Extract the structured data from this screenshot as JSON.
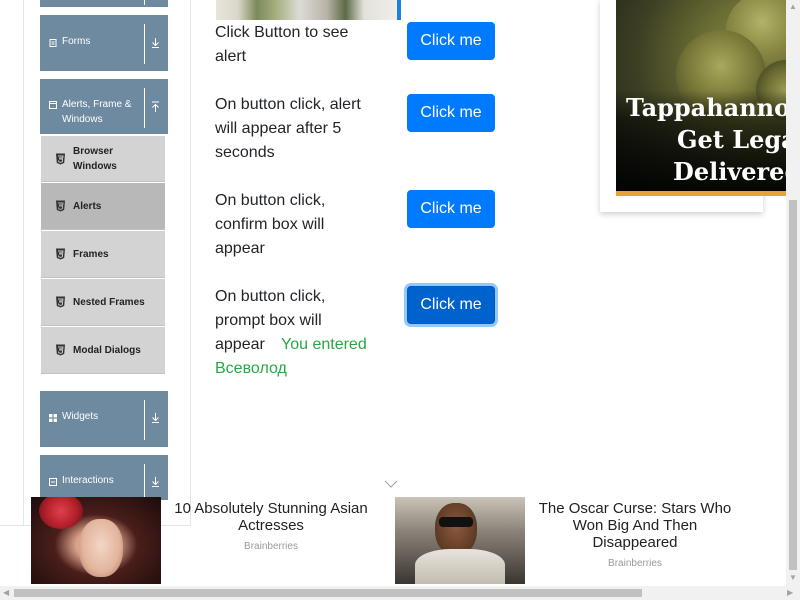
{
  "sidebar": {
    "groups": [
      {
        "label": "Forms"
      },
      {
        "label_line1": "Alerts, Frame &",
        "label_line2": "Windows"
      },
      {
        "label": "Widgets"
      },
      {
        "label": "Interactions"
      }
    ],
    "items": [
      {
        "label_line1": "Browser",
        "label_line2": "Windows"
      },
      {
        "label": "Alerts"
      },
      {
        "label": "Frames"
      },
      {
        "label": "Nested Frames"
      },
      {
        "label": "Modal Dialogs"
      }
    ]
  },
  "content": {
    "rows": [
      {
        "text": "Click Button to see alert",
        "button": "Click me"
      },
      {
        "text": "On button click, alert will appear after 5 seconds",
        "button": "Click me"
      },
      {
        "text": "On button click, confirm box will appear",
        "button": "Click me"
      },
      {
        "text": "On button click, prompt box will appear",
        "button": "Click me",
        "result": "You entered Всеволод"
      }
    ]
  },
  "right_ad": {
    "line1": "Tappahannock",
    "line2": "Get Legal",
    "line3": "Delivered"
  },
  "bottom_ads": [
    {
      "title": "10 Absolutely Stunning Asian Actresses",
      "source": "Brainberries"
    },
    {
      "title": "The Oscar Curse: Stars Who Won Big And Then Disappeared",
      "source": "Brainberries"
    }
  ],
  "colors": {
    "primary_button": "#007bff",
    "sidebar_group": "#6e8aa0",
    "sidebar_item": "#d3d3d3",
    "result_text": "#28a745"
  }
}
